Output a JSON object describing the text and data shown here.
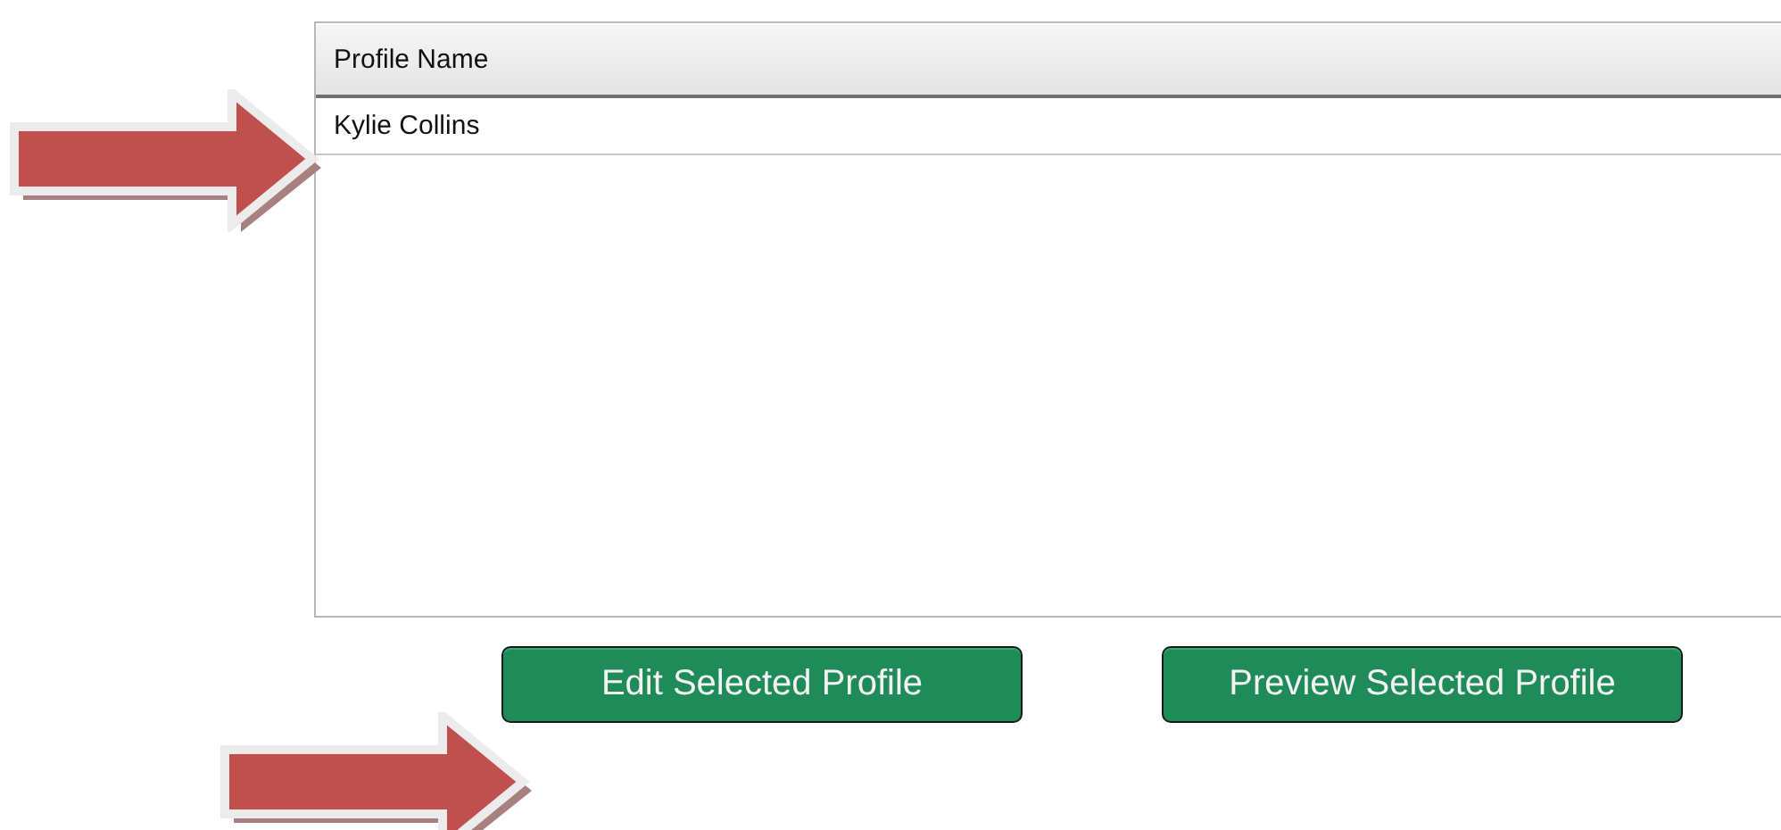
{
  "table": {
    "columns": [
      "Profile Name"
    ],
    "rows": [
      [
        "Kylie Collins"
      ]
    ]
  },
  "buttons": [
    "Edit Selected Profile",
    "Preview Selected Profile"
  ],
  "annotations": [
    {
      "kind": "arrow"
    },
    {
      "kind": "arrow"
    }
  ]
}
